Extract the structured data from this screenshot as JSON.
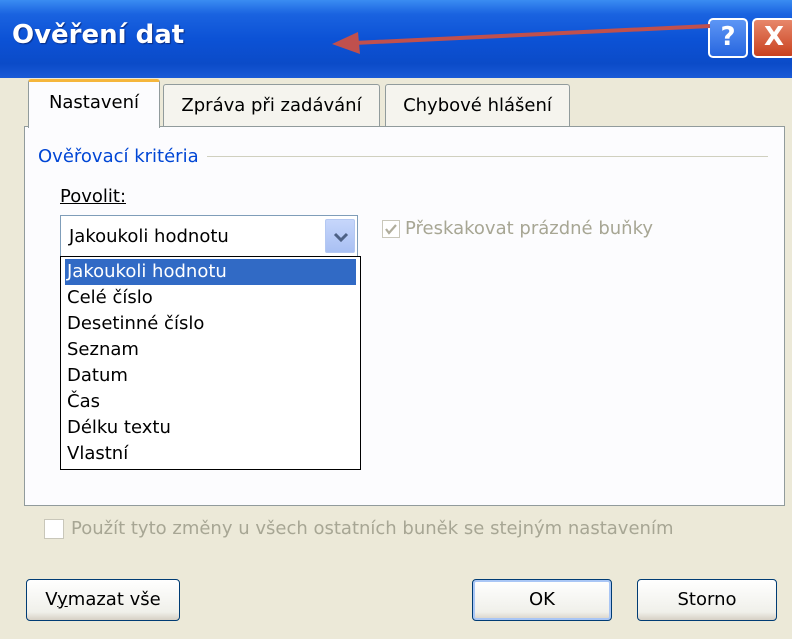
{
  "window": {
    "title": "Ověření dat",
    "help_label": "?",
    "close_label": "X"
  },
  "tabs": [
    {
      "label": "Nastavení",
      "active": true
    },
    {
      "label": "Zpráva při zadávání",
      "active": false
    },
    {
      "label": "Chybové hlášení",
      "active": false
    }
  ],
  "criteria": {
    "group_label": "Ověřovací kritéria",
    "allow_label": "Povolit:",
    "allow_value": "Jakoukoli hodnotu",
    "options": [
      "Jakoukoli hodnotu",
      "Celé číslo",
      "Desetinné číslo",
      "Seznam",
      "Datum",
      "Čas",
      "Délku textu",
      "Vlastní"
    ],
    "selected_index": 0,
    "skip_blank_label": "Přeskakovat prázdné buňky",
    "skip_blank_checked": true
  },
  "apply_all_label": "Použít tyto změny u všech ostatních buněk se stejným nastavením",
  "apply_all_checked": false,
  "buttons": {
    "clear": "Vymazat vše",
    "ok": "OK",
    "cancel": "Storno"
  },
  "colors": {
    "title_bar": "#0c52d6",
    "selection": "#316ac5",
    "group_label": "#0046d5",
    "arrow": "#c0504d"
  }
}
